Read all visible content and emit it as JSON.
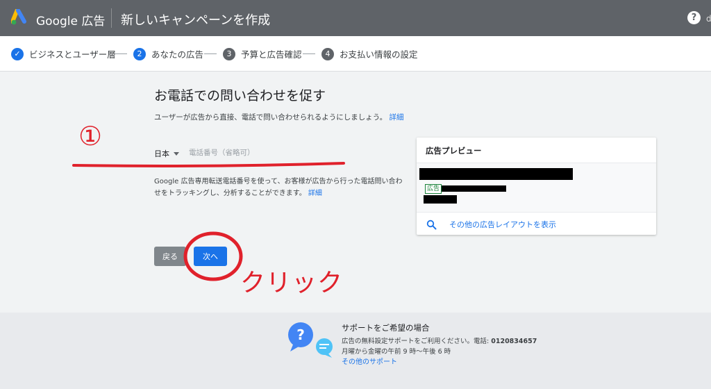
{
  "header": {
    "brand": "Google 広告",
    "title": "新しいキャンペーンを作成",
    "help_glyph": "?",
    "account_partial": "d"
  },
  "stepper": {
    "steps": [
      {
        "label": "ビジネスとユーザー層",
        "state": "done",
        "number": "✓"
      },
      {
        "label": "あなたの広告",
        "state": "active",
        "number": "2"
      },
      {
        "label": "予算と広告確認",
        "state": "todo",
        "number": "3"
      },
      {
        "label": "お支払い情報の設定",
        "state": "todo",
        "number": "4"
      }
    ]
  },
  "main": {
    "heading": "お電話での問い合わせを促す",
    "description": "ユーザーが広告から直接、電話で問い合わせられるようにしましょう。",
    "detail_link": "詳細",
    "country": "日本",
    "phone_placeholder": "電話番号（省略可）",
    "info_text": "Google 広告専用転送電話番号を使って、お客様が広告から行った電話問い合わせをトラッキングし、分析することができます。",
    "info_link": "詳細",
    "back_label": "戻る",
    "next_label": "次へ"
  },
  "preview": {
    "title": "広告プレビュー",
    "ad_badge": "広告",
    "more_layouts": "その他の広告レイアウトを表示"
  },
  "annotations": {
    "number": "①",
    "click": "クリック"
  },
  "footer": {
    "title": "サポートをご希望の場合",
    "line1_prefix": "広告の無料設定サポートをご利用ください。電話:",
    "phone": "0120834657",
    "line2": "月曜から金曜の午前 9 時～午後 6 時",
    "other_support": "その他のサポート"
  },
  "colors": {
    "topbar": "#5f6368",
    "primary": "#1a73e8",
    "annotation_red": "#e0212b"
  }
}
